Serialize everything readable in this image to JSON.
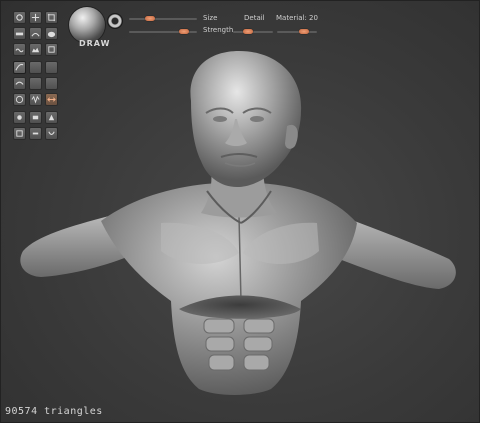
{
  "brush": {
    "name": "DRAW",
    "icon": "sphere-brush-icon"
  },
  "brush_params": {
    "size_label": "Size",
    "strength_label": "Strength",
    "detail_label": "Detail",
    "material_label": "Material: 20"
  },
  "tools": {
    "group1": [
      "rotate-icon",
      "move-icon",
      "crop-icon",
      "flatten-icon",
      "pinch-icon",
      "inflate-icon",
      "smooth-icon",
      "clay-icon",
      "trim-icon"
    ],
    "group2": [
      "curve-icon",
      "blank-icon",
      "blank-icon",
      "lasso-icon",
      "blank-icon",
      "blank-icon",
      "circle-icon",
      "wave-icon",
      "symmetry-icon"
    ],
    "group3": [
      "brush-a-icon",
      "brush-b-icon",
      "brush-c-icon",
      "brush-d-icon",
      "brush-e-icon",
      "brush-f-icon"
    ]
  },
  "status": {
    "triangles": "90574 triangles"
  },
  "colors": {
    "accent": "#e0875a",
    "background": "#3a3a3a",
    "model": "#8e8e8e"
  }
}
